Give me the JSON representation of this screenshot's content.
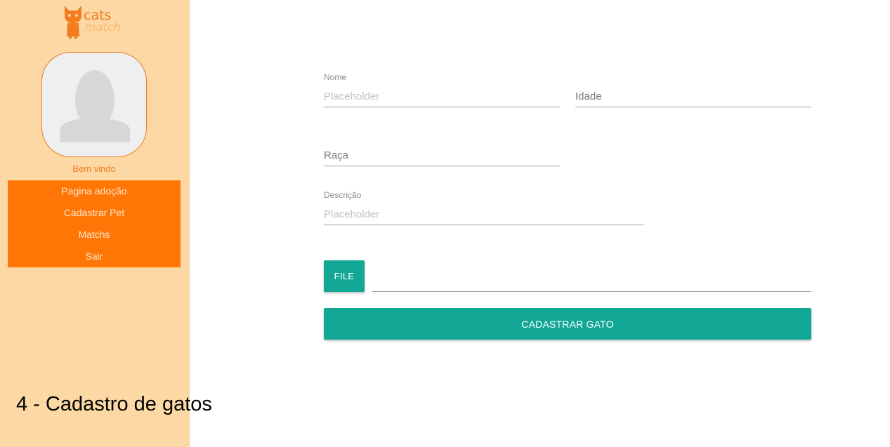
{
  "sidebar": {
    "logo": {
      "line1": "cats",
      "line2": "match",
      "icon": "cat-mascot-icon"
    },
    "avatar_icon": "user-silhouette-icon",
    "welcome": "Bem vindo",
    "nav": [
      "Pagina adoção",
      "Cadastrar Pet",
      "Matchs",
      "Sair"
    ]
  },
  "form": {
    "nome": {
      "label": "Nome",
      "placeholder": "Placeholder"
    },
    "idade": {
      "placeholder": "Idade"
    },
    "raca": {
      "placeholder": "Raça"
    },
    "descricao": {
      "label": "Descrição",
      "placeholder": "Placeholder"
    },
    "file_button": "FILE",
    "submit_button": "CADASTRAR GATO"
  },
  "caption": "4 - Cadastro de gatos",
  "colors": {
    "sidebar_bg": "#fbd8a4",
    "nav_bg": "#ff7606",
    "accent_orange": "#f47c1e",
    "teal": "#13a896"
  }
}
